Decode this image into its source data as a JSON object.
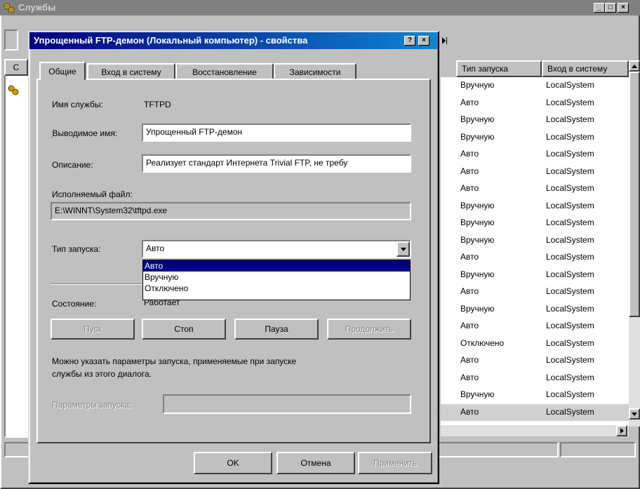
{
  "services_window": {
    "title": "Службы",
    "caption_minimize": "_",
    "caption_maximize": "□",
    "caption_close": "×",
    "columns": [
      "Тип запуска",
      "Вход в систему"
    ],
    "tab_stub": "С",
    "rows": [
      {
        "startup": "Вручную",
        "logon": "LocalSystem"
      },
      {
        "startup": "Авто",
        "logon": "LocalSystem"
      },
      {
        "startup": "Вручную",
        "logon": "LocalSystem"
      },
      {
        "startup": "Вручную",
        "logon": "LocalSystem"
      },
      {
        "startup": "Авто",
        "logon": "LocalSystem"
      },
      {
        "startup": "Авто",
        "logon": "LocalSystem"
      },
      {
        "startup": "Авто",
        "logon": "LocalSystem"
      },
      {
        "startup": "Вручную",
        "logon": "LocalSystem"
      },
      {
        "startup": "Вручную",
        "logon": "LocalSystem"
      },
      {
        "startup": "Вручную",
        "logon": "LocalSystem"
      },
      {
        "startup": "Авто",
        "logon": "LocalSystem"
      },
      {
        "startup": "Вручную",
        "logon": "LocalSystem"
      },
      {
        "startup": "Авто",
        "logon": "LocalSystem"
      },
      {
        "startup": "Вручную",
        "logon": "LocalSystem"
      },
      {
        "startup": "Авто",
        "logon": "LocalSystem"
      },
      {
        "startup": "Отключено",
        "logon": "LocalSystem"
      },
      {
        "startup": "Авто",
        "logon": "LocalSystem"
      },
      {
        "startup": "Авто",
        "logon": "LocalSystem"
      },
      {
        "startup": "Вручную",
        "logon": "LocalSystem"
      },
      {
        "startup": "Авто",
        "logon": "LocalSystem"
      }
    ]
  },
  "dialog": {
    "title": "Упрощенный FTP-демон (Локальный компьютер) - свойства",
    "help_glyph": "?",
    "close_glyph": "×",
    "tabs": [
      "Общие",
      "Вход в систему",
      "Восстановление",
      "Зависимости"
    ],
    "service_name_label": "Имя службы:",
    "service_name_value": "TFTPD",
    "display_name_label": "Выводимое имя:",
    "display_name_value": "Упрощенный FTP-демон",
    "description_label": "Описание:",
    "description_value": "Реализует стандарт Интернета Trivial FTP, не требу",
    "exe_label": "Исполняемый файл:",
    "exe_value": "E:\\WINNT\\System32\\tftpd.exe",
    "startup_label": "Тип запуска:",
    "startup_value": "Авто",
    "startup_options": [
      "Авто",
      "Вручную",
      "Отключено"
    ],
    "status_label": "Состояние:",
    "status_value": "Работает",
    "btn_start": "Пуск",
    "btn_stop": "Стоп",
    "btn_pause": "Пауза",
    "btn_continue": "Продолжить",
    "hint_line1": "Можно указать параметры запуска, применяемые при запуске",
    "hint_line2": "службы из этого диалога.",
    "params_label": "Параметры запуска:",
    "btn_ok": "OK",
    "btn_cancel": "Отмена",
    "btn_apply": "Применить"
  },
  "colors": {
    "desktop": "#008080",
    "active_title": "#000080",
    "selection": "#000080"
  }
}
